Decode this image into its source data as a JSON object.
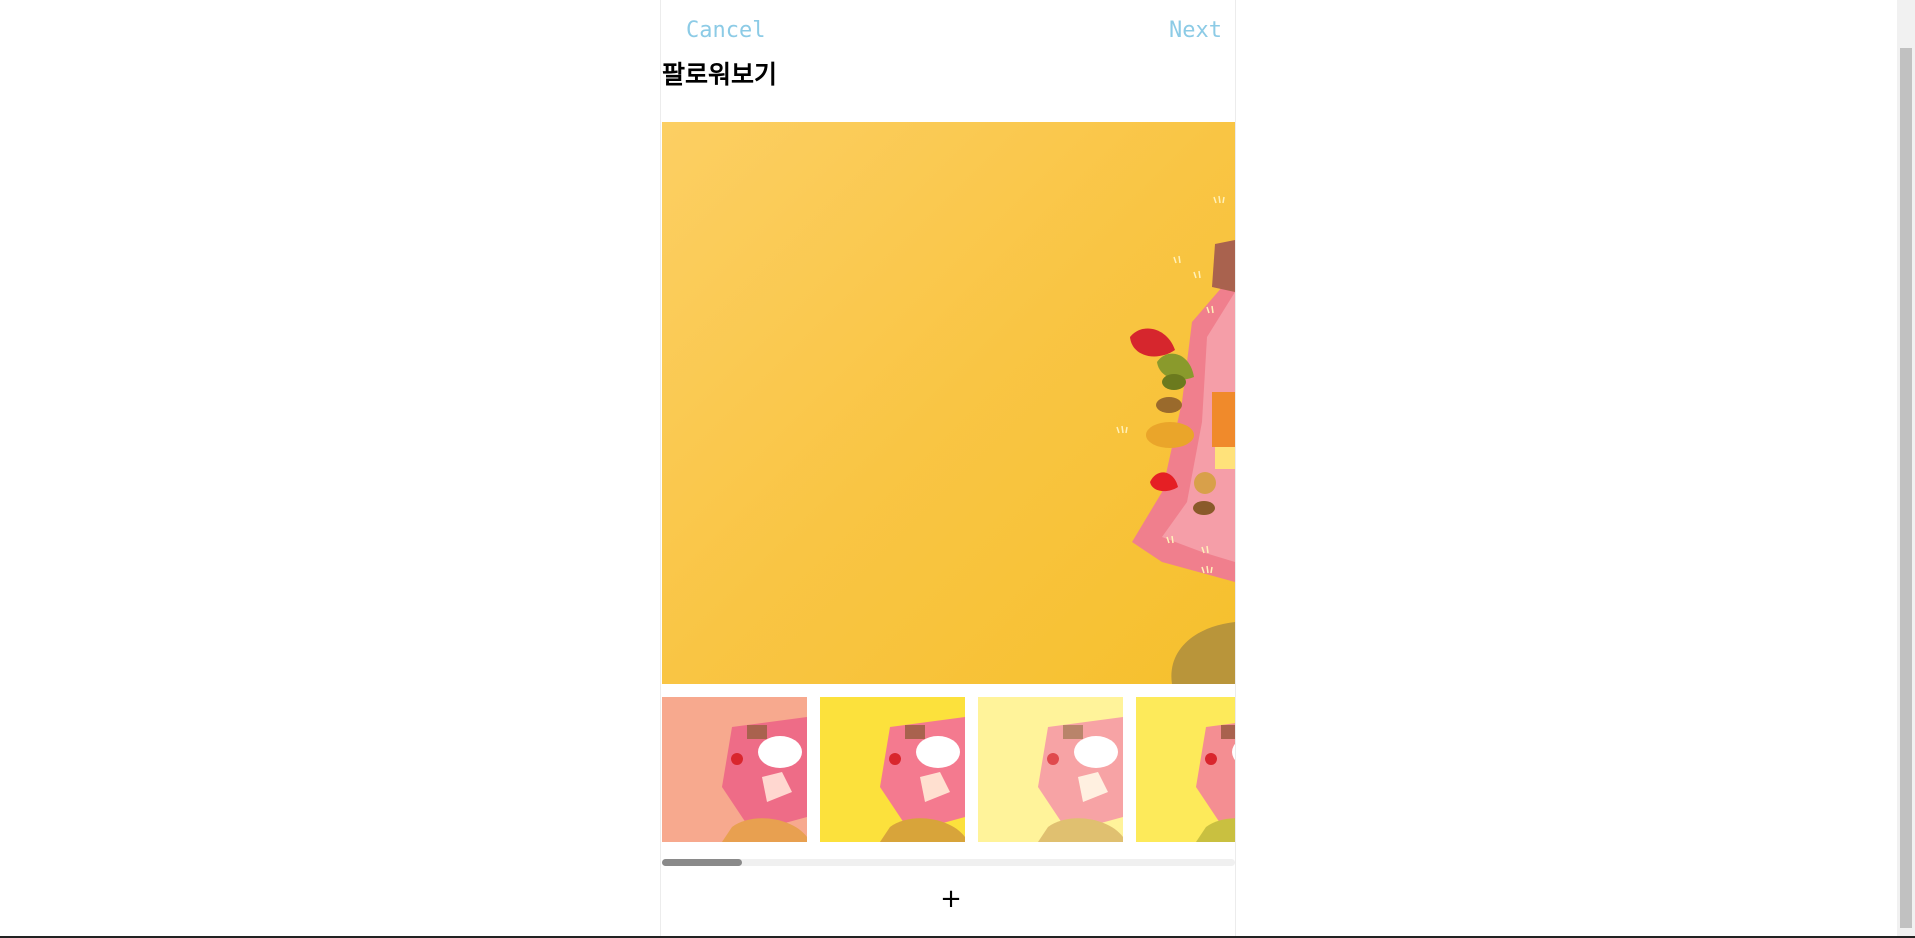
{
  "header": {
    "cancel_label": "Cancel",
    "next_label": "Next",
    "title": "팔로워보기"
  },
  "colors": {
    "nav_text": "#8ccbe6",
    "title_text": "#000000",
    "scroll_thumb": "#8a8a8a"
  },
  "preview": {
    "icon": "photo-preview"
  },
  "thumbnails": [
    {
      "filter": "warm-pink"
    },
    {
      "filter": "bright-yellow"
    },
    {
      "filter": "pale-yellow"
    },
    {
      "filter": "lemon"
    }
  ],
  "thumbnail_scroll": {
    "visible_fraction": 0.14
  },
  "footer": {
    "add_label": "+"
  }
}
